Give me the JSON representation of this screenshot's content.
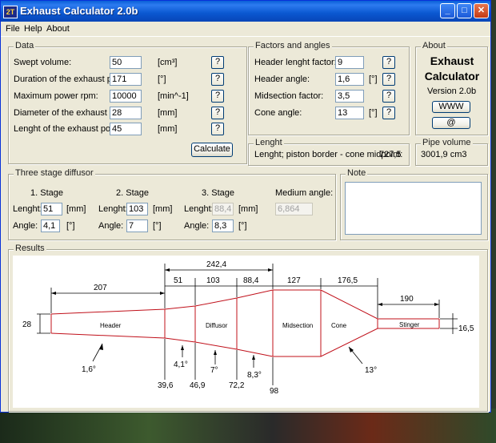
{
  "window": {
    "title": "Exhaust Calculator 2.0b",
    "icon_text": "2T"
  },
  "titlebar_buttons": [
    "minimize-icon",
    "maximize-icon",
    "close-icon"
  ],
  "menu": [
    "File",
    "Help",
    "About"
  ],
  "data_group": {
    "title": "Data",
    "rows": [
      {
        "label": "Swept volume:",
        "value": "50",
        "unit": "[cm³]",
        "help": "?"
      },
      {
        "label": "Duration of the exhaust port:",
        "value": "171",
        "unit": "[°]",
        "help": "?"
      },
      {
        "label": "Maximum power rpm:",
        "value": "10000",
        "unit": "[min^-1]",
        "help": "?"
      },
      {
        "label": "Diameter of the exhaust port:",
        "value": "28",
        "unit": "[mm]",
        "help": "?"
      },
      {
        "label": "Lenght of the exhaust port:",
        "value": "45",
        "unit": "[mm]",
        "help": "?"
      }
    ],
    "calculate": "Calculate"
  },
  "factors_group": {
    "title": "Factors and angles",
    "rows": [
      {
        "label": "Header lenght factor:",
        "value": "9",
        "unit": "",
        "help": "?"
      },
      {
        "label": "Header angle:",
        "value": "1,6",
        "unit": "[°]",
        "help": "?"
      },
      {
        "label": "Midsection factor:",
        "value": "3,5",
        "unit": "",
        "help": "?"
      },
      {
        "label": "Cone angle:",
        "value": "13",
        "unit": "[°]",
        "help": "?"
      }
    ]
  },
  "about_group": {
    "title": "About",
    "name1": "Exhaust",
    "name2": "Calculator",
    "version": "Version 2.0b",
    "www": "WWW",
    "mail": "@"
  },
  "lenght_group": {
    "title": "Lenght",
    "text": "Lenght; piston border - cone midpoint:",
    "value": "727,5"
  },
  "pipe_volume_group": {
    "title": "Pipe volume",
    "value": "3001,9 cm3"
  },
  "diffusor_group": {
    "title": "Three stage diffusor",
    "stages": [
      {
        "title": "1. Stage",
        "lenght_label": "Lenght:",
        "lenght": "51",
        "lenght_unit": "[mm]",
        "angle_label": "Angle:",
        "angle": "4,1",
        "angle_unit": "[°]"
      },
      {
        "title": "2. Stage",
        "lenght_label": "Lenght:",
        "lenght": "103",
        "lenght_unit": "[mm]",
        "angle_label": "Angle:",
        "angle": "7",
        "angle_unit": "[°]"
      },
      {
        "title": "3. Stage",
        "lenght_label": "Lenght:",
        "lenght": "88,4",
        "lenght_unit": "[mm]",
        "angle_label": "Angle:",
        "angle": "8,3",
        "angle_unit": "[°]"
      }
    ],
    "medium_angle_label": "Medium angle:",
    "medium_angle": "6,864"
  },
  "note_group": {
    "title": "Note"
  },
  "results_group": {
    "title": "Results",
    "diagram": {
      "sections": [
        "Header",
        "Diffusor",
        "Midsection",
        "Cone",
        "Stinger"
      ],
      "top_dims": [
        "207",
        "51",
        "103",
        "88,4",
        "127",
        "176,5"
      ],
      "span_dim": "242,4",
      "stinger_dim": "190",
      "inlet_diameter": "28",
      "outlet_diameter": "16,5",
      "bottom_diameters": [
        "39,6",
        "46,9",
        "72,2",
        "98"
      ],
      "angles": [
        "1,6°",
        "4,1°",
        "7°",
        "8,3°",
        "13°"
      ]
    }
  }
}
